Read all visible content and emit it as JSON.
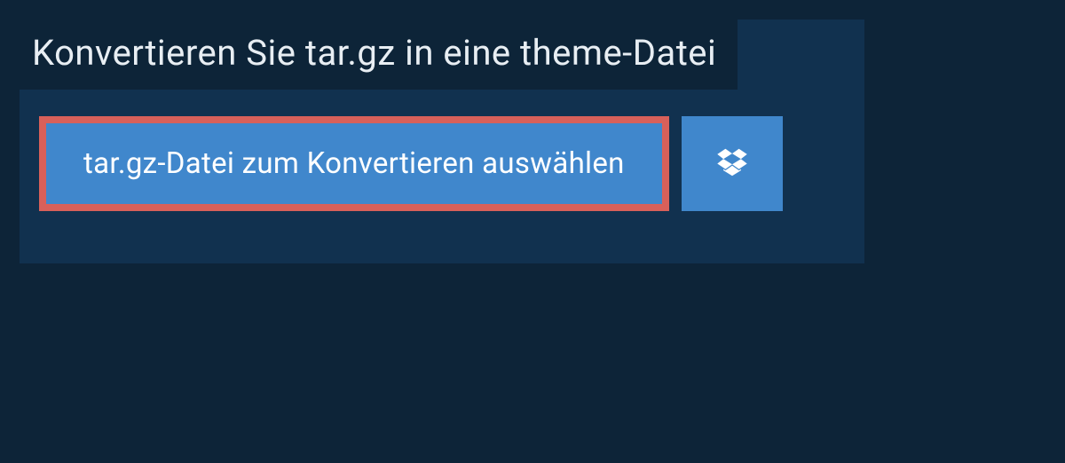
{
  "heading": "Konvertieren Sie tar.gz in eine theme-Datei",
  "select_button_label": "tar.gz-Datei zum Konvertieren auswählen",
  "colors": {
    "background": "#0d2438",
    "panel": "#11314f",
    "button": "#4087cc",
    "highlight_border": "#d8605a",
    "text": "#ffffff"
  }
}
